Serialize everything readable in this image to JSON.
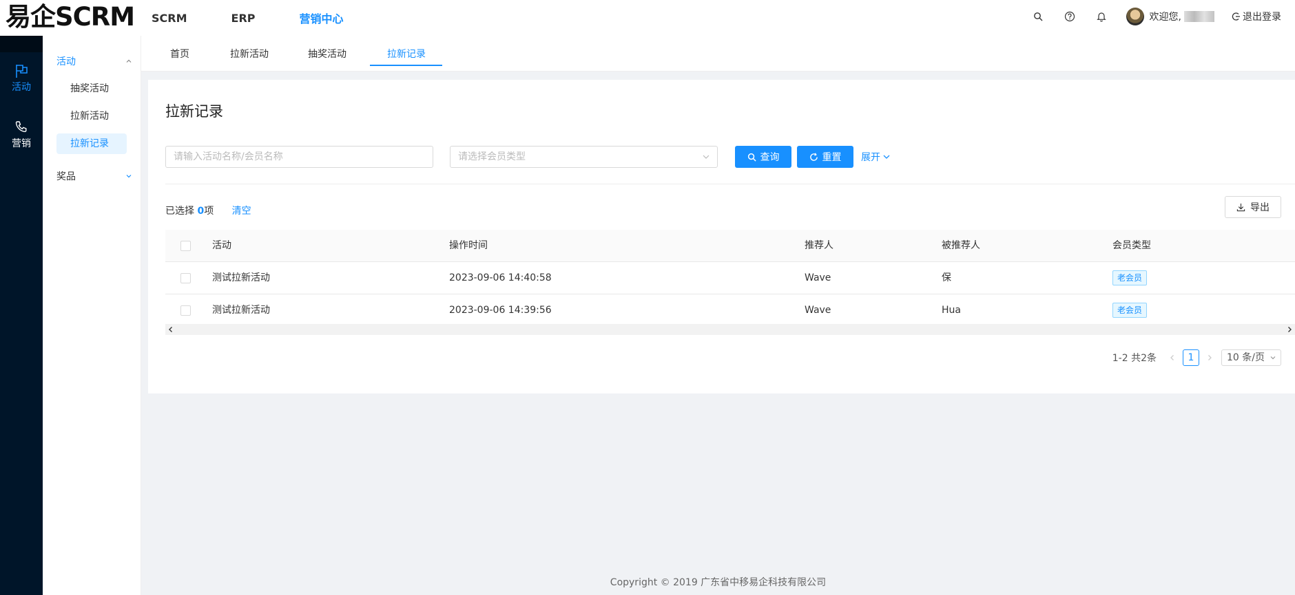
{
  "brand": {
    "logo": "易企SCRM"
  },
  "topnav": [
    "SCRM",
    "ERP",
    "营销中心"
  ],
  "user": {
    "welcome": "欢迎您,",
    "logout": "退出登录"
  },
  "sidebar": {
    "main": [
      {
        "label": "活动"
      },
      {
        "label": "营销"
      }
    ],
    "sub": {
      "group1": "活动",
      "items": [
        "抽奖活动",
        "拉新活动",
        "拉新记录"
      ],
      "group2": "奖品"
    }
  },
  "tabs": [
    "首页",
    "拉新活动",
    "抽奖活动",
    "拉新记录"
  ],
  "page": {
    "title": "拉新记录"
  },
  "filters": {
    "name_placeholder": "请输入活动名称/会员名称",
    "type_placeholder": "请选择会员类型",
    "search": "查询",
    "reset": "重置",
    "expand": "展开"
  },
  "selection": {
    "prefix": "已选择 ",
    "count": "0",
    "suffix": "项",
    "clear": "清空"
  },
  "export": "导出",
  "table": {
    "columns": [
      "活动",
      "操作时间",
      "推荐人",
      "被推荐人",
      "会员类型"
    ],
    "rows": [
      [
        "测试拉新活动",
        "2023-09-06 14:40:58",
        "Wave",
        "保",
        "老会员"
      ],
      [
        "测试拉新活动",
        "2023-09-06 14:39:56",
        "Wave",
        "Hua",
        "老会员"
      ]
    ]
  },
  "pagination": {
    "summary": "1-2 共2条",
    "current": "1",
    "page_size": "10 条/页"
  },
  "footer": "Copyright © 2019 广东省中移易企科技有限公司",
  "colors": {
    "primary": "#1890ff",
    "sidebar": "#001529"
  }
}
